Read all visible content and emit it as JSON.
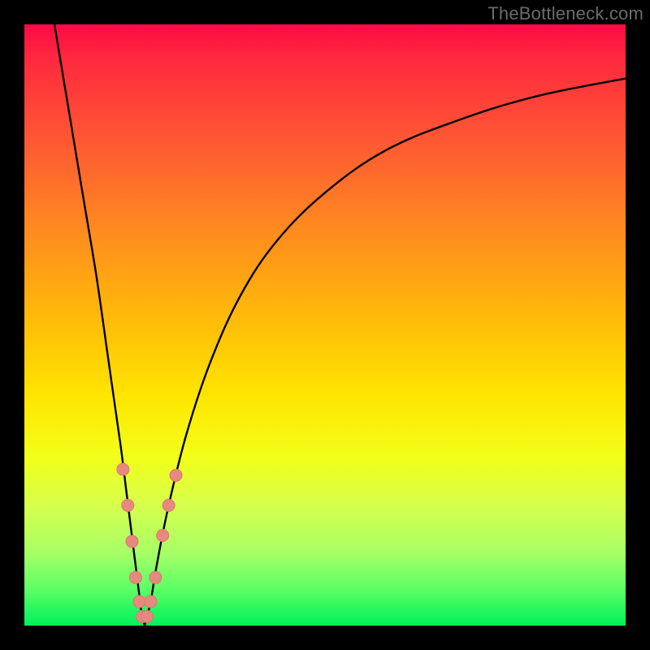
{
  "watermark": "TheBottleneck.com",
  "chart_data": {
    "type": "line",
    "title": "",
    "xlabel": "",
    "ylabel": "",
    "xlim": [
      0,
      100
    ],
    "ylim": [
      0,
      100
    ],
    "grid": false,
    "legend": false,
    "series": [
      {
        "name": "left-branch",
        "x": [
          5,
          8,
          10,
          12,
          14,
          16,
          17,
          18,
          19,
          19.5,
          20
        ],
        "y": [
          100,
          82,
          70,
          58,
          44,
          30,
          22,
          14,
          6,
          2,
          0
        ]
      },
      {
        "name": "right-branch",
        "x": [
          20,
          21,
          22,
          24,
          27,
          31,
          36,
          42,
          50,
          60,
          72,
          85,
          100
        ],
        "y": [
          0,
          4,
          10,
          20,
          32,
          44,
          55,
          64,
          72,
          79,
          84,
          88,
          91
        ]
      }
    ],
    "markers": [
      {
        "series": "left-branch",
        "x": 16.4,
        "y": 26
      },
      {
        "series": "left-branch",
        "x": 17.2,
        "y": 20
      },
      {
        "series": "left-branch",
        "x": 17.9,
        "y": 14
      },
      {
        "series": "left-branch",
        "x": 18.5,
        "y": 8
      },
      {
        "series": "left-branch",
        "x": 19.1,
        "y": 4
      },
      {
        "series": "left-branch",
        "x": 19.6,
        "y": 1.5
      },
      {
        "series": "right-branch",
        "x": 20.4,
        "y": 1.5
      },
      {
        "series": "right-branch",
        "x": 21.0,
        "y": 4
      },
      {
        "series": "right-branch",
        "x": 21.8,
        "y": 8
      },
      {
        "series": "right-branch",
        "x": 23.0,
        "y": 15
      },
      {
        "series": "right-branch",
        "x": 24.0,
        "y": 20
      },
      {
        "series": "right-branch",
        "x": 25.2,
        "y": 25
      }
    ],
    "colors": {
      "line": "#000000",
      "marker_fill": "#e8897f",
      "marker_stroke": "#d9776d"
    },
    "background_gradient": {
      "type": "vertical-value-map",
      "stops": [
        {
          "value": 100,
          "color": "#ff0a46"
        },
        {
          "value": 80,
          "color": "#ff5a33"
        },
        {
          "value": 60,
          "color": "#ffb80a"
        },
        {
          "value": 40,
          "color": "#ffe600"
        },
        {
          "value": 20,
          "color": "#d6ff4d"
        },
        {
          "value": 0,
          "color": "#00f05a"
        }
      ]
    }
  }
}
